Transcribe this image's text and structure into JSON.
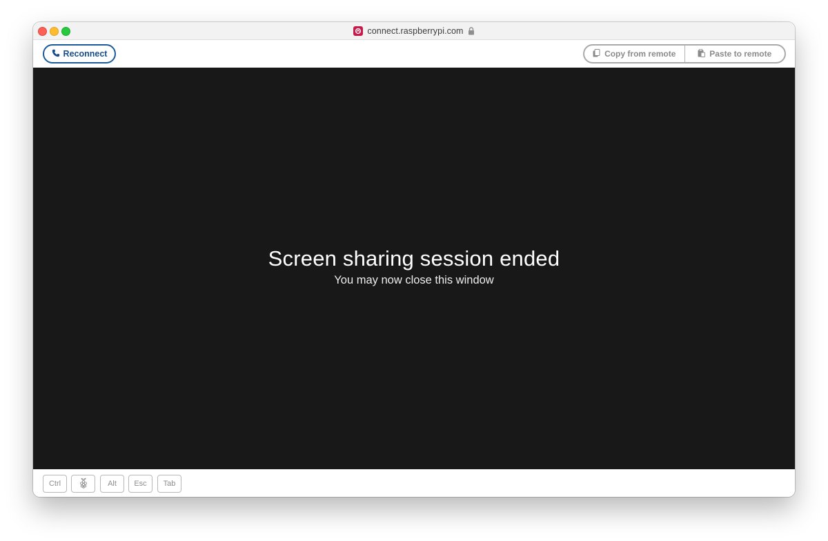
{
  "browser": {
    "url": "connect.raspberrypi.com",
    "site_icon": "raspberry-pi-connect-icon",
    "secure_icon": "lock-icon"
  },
  "toolbar": {
    "reconnect_label": "Reconnect",
    "reconnect_icon": "phone-icon",
    "copy_label": "Copy from remote",
    "copy_icon": "clipboard-icon",
    "paste_label": "Paste to remote",
    "paste_icon": "clipboard-icon"
  },
  "screen": {
    "title": "Screen sharing session ended",
    "subtitle": "You may now close this window"
  },
  "keys": [
    {
      "label": "Ctrl"
    },
    {
      "label": "",
      "icon": "raspberry-pi-logo-icon"
    },
    {
      "label": "Alt"
    },
    {
      "label": "Esc"
    },
    {
      "label": "Tab"
    }
  ],
  "colors": {
    "accent": "#1a5a9a",
    "screen_background": "#181818",
    "brand": "#c51a4a"
  }
}
